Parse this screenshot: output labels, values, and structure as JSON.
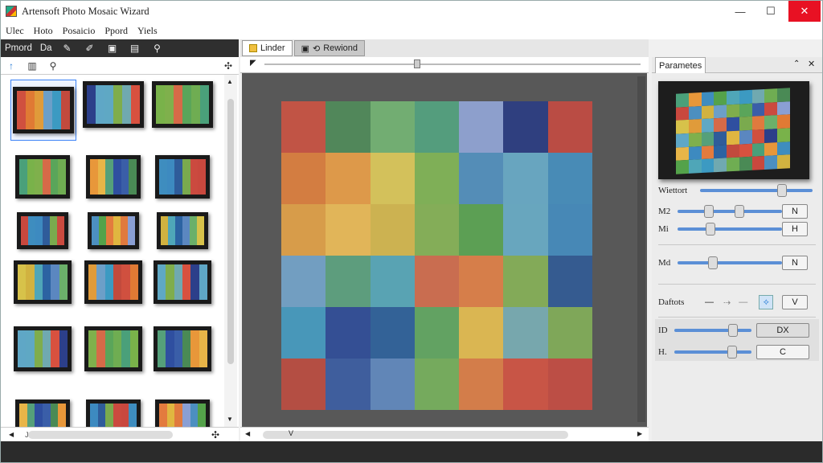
{
  "window": {
    "title": "Artensoft Photo Mosaic Wizard",
    "minimize": "—",
    "maximize": "☐",
    "close": "✕"
  },
  "menu": [
    "Ulec",
    "Hoto",
    "Posaicio",
    "Ppord",
    "Yiels"
  ],
  "left_toolbar": {
    "label_a": "Pmord",
    "label_b": "Da"
  },
  "left_bottom": {
    "field": "Jns"
  },
  "center_tabs": {
    "tab1": "Linder",
    "tab2": "Rewiond"
  },
  "center_bottom": {
    "field": "V"
  },
  "right_panel": {
    "tab": "Parametes",
    "rows": {
      "r1_label": "Wiettort",
      "r2_label": "M2",
      "r2_button": "N",
      "r3_label": "Mi",
      "r3_button": "H",
      "r4_label": "Md",
      "r4_button": "N",
      "r5_label": "Daftots",
      "r5_button": "V",
      "r6_label": "ID",
      "r6_button": "DX",
      "r7_label": "H.",
      "r7_button": "C"
    },
    "sliders": {
      "r1": 0.75,
      "r2a": 0.28,
      "r2b": 0.6,
      "r3": 0.3,
      "r4": 0.32,
      "r6": 0.8,
      "r7": 0.79
    }
  },
  "colors": {
    "mosaic": [
      "#d0503f",
      "#4a8a55",
      "#6bb06a",
      "#4aa07a",
      "#8a9fd4",
      "#2c3f8a",
      "#c9483e",
      "#e07a34",
      "#e8973a",
      "#d7c24a",
      "#79b24a",
      "#4c8fc0",
      "#5fa7c6",
      "#3e8dbf",
      "#e09b3a",
      "#e8b548",
      "#d1b240",
      "#7fb04c",
      "#54a24a",
      "#5fa8c4",
      "#3d8ac0",
      "#6c9fc8",
      "#55a07a",
      "#4fa6b8",
      "#d66a48",
      "#e37b3e",
      "#7fad4c",
      "#2f5c9a",
      "#3c9ac2",
      "#2f4fa0",
      "#2c63a2",
      "#5aa55a",
      "#e0b640",
      "#70a9b0",
      "#7aaa4e",
      "#c24a3d",
      "#3a5ea8",
      "#5b87c0",
      "#6fad52",
      "#e07a3e",
      "#d8513f",
      "#cb4a3f"
    ]
  }
}
